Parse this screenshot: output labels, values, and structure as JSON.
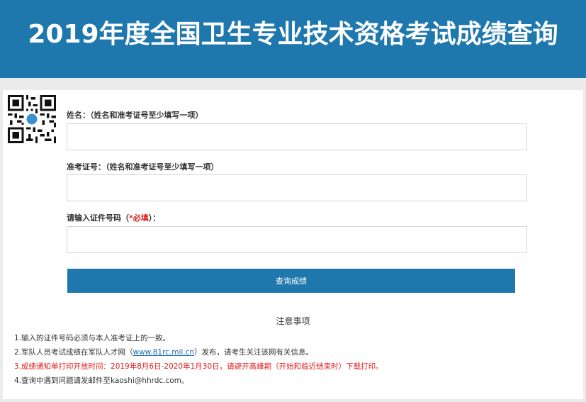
{
  "header": {
    "title": "2019年度全国卫生专业技术资格考试成绩查询"
  },
  "form": {
    "name_label": "姓名：（姓名和准考证号至少填写一项）",
    "ticket_label": "准考证号：（姓名和准考证号至少填写一项）",
    "id_label_prefix": "请输入证件号码（",
    "id_label_required": "*必填",
    "id_label_suffix": "）：",
    "name_value": "",
    "ticket_value": "",
    "id_value": "",
    "submit_label": "查询成绩"
  },
  "notice": {
    "title": "注意事项",
    "items": [
      {
        "text": "1.输入的证件号码必须与本人准考证上的一致。"
      },
      {
        "prefix": "2.军队人员考试成绩在军队人才网（",
        "link": "www.81rc.mil.cn",
        "suffix": "）发布，请考生关注该网有关信息。"
      },
      {
        "text": "3.成绩通知单打印开放时间：2019年8月6日-2020年1月30日，请避开高峰期（开始和临近结束时）下载打印。"
      },
      {
        "text": "4.查询中遇到问题请发邮件至kaoshi@hhrdc.com。"
      }
    ]
  },
  "colors": {
    "brand": "#1e78ad",
    "warning": "#e02020",
    "background": "#ebebeb"
  },
  "icons": {
    "qr": "qr-code-icon"
  }
}
